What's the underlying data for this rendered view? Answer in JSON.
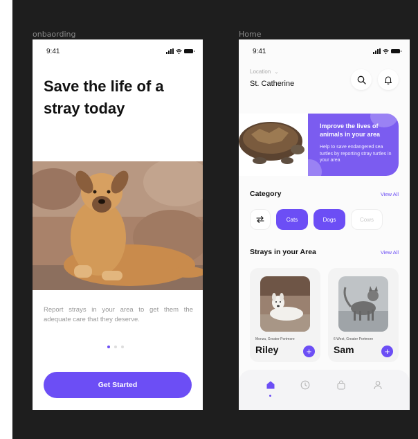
{
  "frames": {
    "onboarding_label": "onbaording",
    "home_label": "Home"
  },
  "status_bar": {
    "time": "9:41"
  },
  "onboarding": {
    "headline": "Save the life of a stray today",
    "description": "Report strays in your area to get them the adequate care that they deserve.",
    "page_indicator": {
      "pages": 3,
      "active": 1
    },
    "cta_label": "Get Started"
  },
  "home": {
    "location_label": "Location",
    "location_value": "St. Catherine",
    "banner": {
      "title": "Improve the lives of animals in your area",
      "text": "Help to save endangered sea turtles by reporting stray turtles in your area"
    },
    "category": {
      "title": "Category",
      "view_all": "View All",
      "chips": [
        "Cats",
        "Dogs",
        "Cows"
      ],
      "selected": [
        "Cats",
        "Dogs"
      ]
    },
    "strays": {
      "title": "Strays in your Area",
      "view_all": "View All",
      "cards": [
        {
          "location": "Monza, Greater Portmore",
          "name": "Riley",
          "add": "+"
        },
        {
          "location": "6 West, Greater Portmore",
          "name": "Sam",
          "add": "+"
        }
      ]
    },
    "tabbar": {
      "items": [
        "home-icon",
        "clock-icon",
        "bag-icon",
        "profile-icon"
      ],
      "active": "home-icon"
    }
  },
  "colors": {
    "accent": "#6c4ef5",
    "canvas": "#1e1e1e",
    "banner": "#7b5cf0"
  }
}
